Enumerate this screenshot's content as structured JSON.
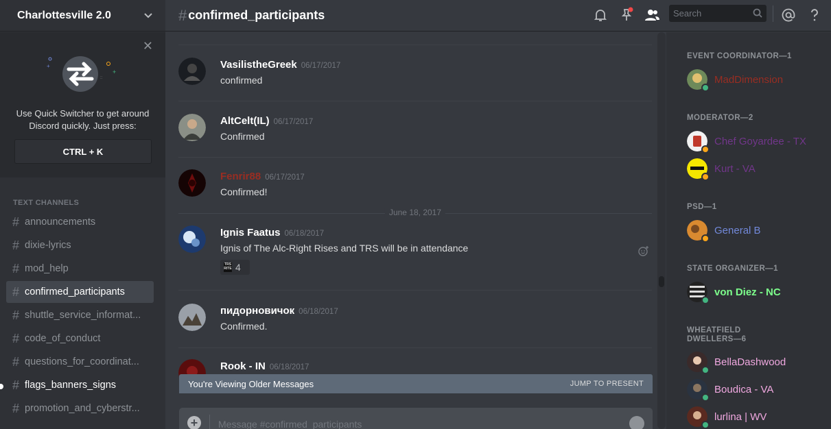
{
  "guild": {
    "name": "Charlottesville 2.0"
  },
  "quick_switcher": {
    "text": "Use Quick Switcher to get around Discord quickly. Just press:",
    "shortcut": "CTRL + K"
  },
  "sidebar": {
    "category": "TEXT CHANNELS",
    "channels": [
      {
        "name": "announcements"
      },
      {
        "name": "dixie-lyrics"
      },
      {
        "name": "mod_help"
      },
      {
        "name": "confirmed_participants"
      },
      {
        "name": "shuttle_service_informat..."
      },
      {
        "name": "code_of_conduct"
      },
      {
        "name": "questions_for_coordinat..."
      },
      {
        "name": "flags_banners_signs"
      },
      {
        "name": "promotion_and_cyberstr..."
      }
    ]
  },
  "header": {
    "hash": "#",
    "channel": "confirmed_participants",
    "search_placeholder": "Search"
  },
  "messages": [
    {
      "author": "VasilistheGreek",
      "timestamp": "06/17/2017",
      "text": "confirmed",
      "color": "#ffffff"
    },
    {
      "author": "AltCelt(IL)",
      "timestamp": "06/17/2017",
      "text": "Confirmed",
      "color": "#ffffff"
    },
    {
      "author": "Fenrir88",
      "timestamp": "06/17/2017",
      "text": "Confirmed!",
      "color": "#992d22"
    },
    {
      "author": "Ignis Faatus",
      "timestamp": "06/18/2017",
      "text": "Ignis of The Alc-Right Rises and TRS will be in attendance",
      "color": "#ffffff",
      "reaction": {
        "emoji": "TRS RITE",
        "count": "4"
      }
    },
    {
      "author": "пидорновичок",
      "timestamp": "06/18/2017",
      "text": "Confirmed.",
      "color": "#ffffff"
    },
    {
      "author": "Rook - IN",
      "timestamp": "06/18/2017",
      "text": "",
      "color": "#ffffff"
    }
  ],
  "date_divider": "June 18, 2017",
  "older_bar": {
    "text": "You're Viewing Older Messages",
    "action": "JUMP TO PRESENT"
  },
  "composer": {
    "placeholder": "Message #confirmed_participants"
  },
  "members": {
    "groups": [
      {
        "role": "EVENT COORDINATOR—1",
        "members": [
          {
            "name": "MadDimension",
            "color": "#992d22",
            "status": "#43b581"
          }
        ]
      },
      {
        "role": "MODERATOR—2",
        "members": [
          {
            "name": "Chef Goyardee - TX",
            "color": "#71368a",
            "status": "#faa61a"
          },
          {
            "name": "Kurt - VA",
            "color": "#71368a",
            "status": "#faa61a"
          }
        ]
      },
      {
        "role": "PSD—1",
        "members": [
          {
            "name": "General B",
            "color": "#7289da",
            "status": "#faa61a"
          }
        ]
      },
      {
        "role": "STATE ORGANIZER—1",
        "members": [
          {
            "name": "von Diez - NC",
            "color": "#7dff8c",
            "status": "#43b581"
          }
        ]
      },
      {
        "role": "WHEATFIELD DWELLERS—6",
        "members": [
          {
            "name": "BellaDashwood",
            "color": "#f0a8e0",
            "status": "#43b581"
          },
          {
            "name": "Boudica - VA",
            "color": "#f0a8e0",
            "status": "#43b581"
          },
          {
            "name": "lurlina | WV",
            "color": "#f0a8e0",
            "status": "#43b581"
          }
        ]
      }
    ]
  }
}
